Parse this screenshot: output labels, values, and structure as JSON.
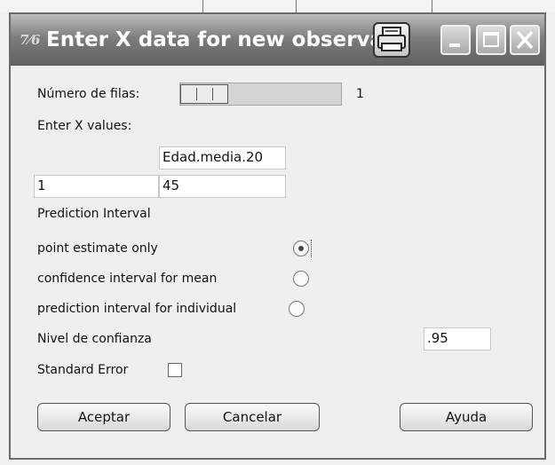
{
  "window": {
    "title": "Enter X data for new observatio",
    "app_icon": "7⁄6"
  },
  "rows": {
    "label": "Número de filas:",
    "slider_value": "1"
  },
  "x_values": {
    "label": "Enter X values:",
    "column_header": "Edad.media.20",
    "row_label": "1",
    "value": "45"
  },
  "prediction": {
    "heading": "Prediction Interval",
    "options": [
      {
        "label": "point estimate only",
        "selected": true
      },
      {
        "label": "confidence interval for mean",
        "selected": false
      },
      {
        "label": "prediction interval for individual",
        "selected": false
      }
    ]
  },
  "confidence": {
    "label": "Nivel de confianza",
    "value": ".95"
  },
  "standard_error": {
    "label": "Standard Error",
    "checked": false
  },
  "buttons": {
    "accept": "Aceptar",
    "cancel": "Cancelar",
    "help": "Ayuda"
  },
  "colors": {
    "titlebar": "#7d7d7d",
    "dialog_bg": "#efefef"
  },
  "icons": [
    "print-icon",
    "minimize-icon",
    "maximize-icon",
    "close-icon"
  ]
}
